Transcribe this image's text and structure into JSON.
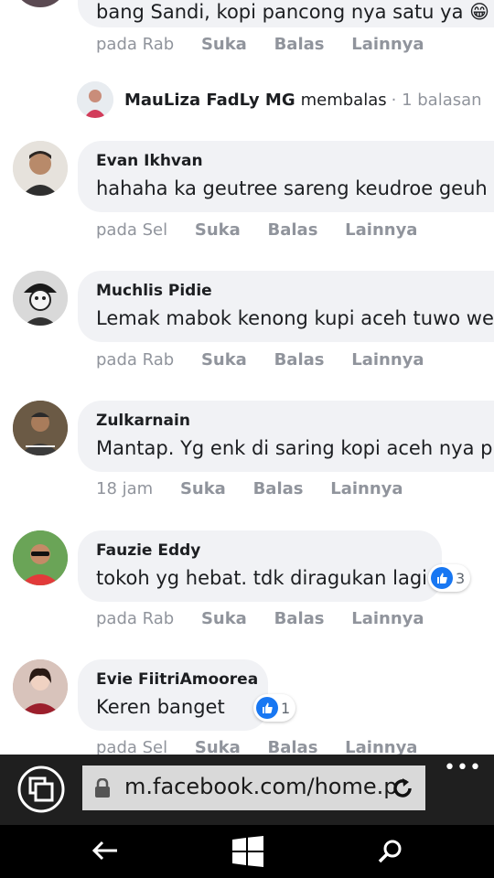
{
  "top_comment": {
    "text": "bang Sandi, kopi pancong nya satu ya 😁",
    "actions": {
      "time": "pada Rab",
      "like": "Suka",
      "reply": "Balas",
      "more": "Lainnya"
    }
  },
  "reply_summary": {
    "name": "MauLiza FadLy MG",
    "verb": "membalas",
    "count": "· 1 balasan"
  },
  "comments": [
    {
      "name": "Evan Ikhvan",
      "text": "hahaha ka geutree sareng keudroe geuh",
      "time": "pada Sel",
      "like": "Suka",
      "reply": "Balas",
      "more": "Lainnya"
    },
    {
      "name": "Muchlis Pidie",
      "text": "Lemak mabok kenong kupi aceh tuwo we",
      "time": "pada Rab",
      "like": "Suka",
      "reply": "Balas",
      "more": "Lainnya"
    },
    {
      "name": "Zulkarnain",
      "text": "Mantap. Yg enk di saring kopi aceh nya p",
      "time": "18 jam",
      "like": "Suka",
      "reply": "Balas",
      "more": "Lainnya"
    },
    {
      "name": "Fauzie Eddy",
      "text": "tokoh yg hebat. tdk diragukan lagi",
      "time": "pada Rab",
      "like": "Suka",
      "reply": "Balas",
      "more": "Lainnya",
      "reactions": "3"
    },
    {
      "name": "Evie FiitriAmoorea",
      "text": "Keren banget",
      "time": "pada Sel",
      "like": "Suka",
      "reply": "Balas",
      "more": "Lainnya",
      "reactions": "1"
    }
  ],
  "browser": {
    "url": "m.facebook.com/home.p",
    "menu": "•••"
  },
  "colors": {
    "bubble": "#f1f2f5",
    "like_blue": "#1877f2",
    "meta_gray": "#90949c"
  }
}
